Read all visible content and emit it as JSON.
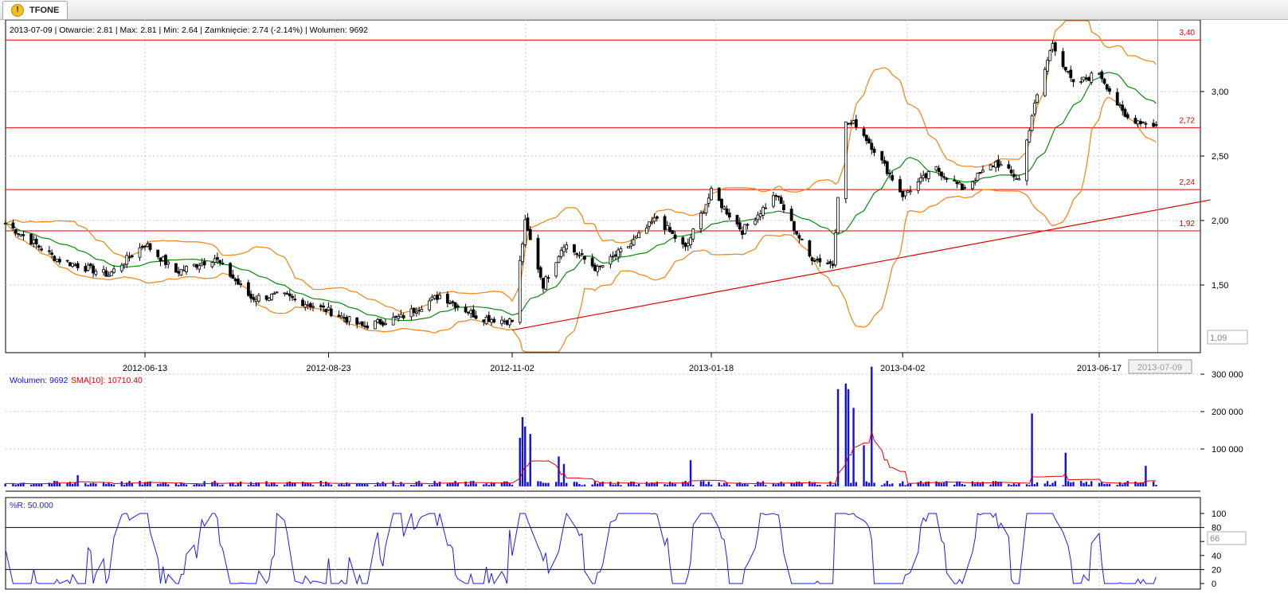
{
  "tab": {
    "label": "TFONE",
    "icon": "warning-icon"
  },
  "info_bar": {
    "date": "2013-07-09",
    "open": "Otwarcie: 2.81",
    "max": "Max: 2.81",
    "min": "Min: 2.64",
    "close": "Zamknięcie: 2.74 (-2.14%)",
    "volume": "Wolumen: 9692",
    "text": "2013-07-09 | Otwarcie: 2.81 | Max: 2.81 | Min: 2.64 | Zamknięcie: 2.74 (-2.14%)   | Wolumen: 9692"
  },
  "colors": {
    "candle": "#000000",
    "bollinger": "#f08a24",
    "sma": "#0a8a0a",
    "level": "#e00000",
    "volume_bar": "#1010e0",
    "volume_sma": "#e00000",
    "williams": "#1a1aff"
  },
  "chart_data": [
    {
      "type": "candlestick",
      "x_ticks": [
        "2012-06-13",
        "2012-08-23",
        "2012-11-02",
        "2013-01-18",
        "2013-04-02",
        "2013-06-17"
      ],
      "current_date_label": "2013-07-09",
      "y_ticks": [
        "3,00",
        "2,50",
        "2,00",
        "1,50"
      ],
      "ylim": [
        1.09,
        3.5
      ],
      "min_price_label": "1,09",
      "horizontal_levels": [
        {
          "value": 3.4,
          "label": "3,40"
        },
        {
          "value": 2.72,
          "label": "2,72"
        },
        {
          "value": 2.24,
          "label": "2,24"
        },
        {
          "value": 1.92,
          "label": "1,92"
        }
      ],
      "trendline": {
        "start": [
          "2012-11-02",
          1.15
        ],
        "end": [
          "2013-07-30",
          2.16
        ]
      },
      "close_anchors": [
        [
          "2012-04-20",
          1.98
        ],
        [
          "2012-05-10",
          1.7
        ],
        [
          "2012-05-30",
          1.58
        ],
        [
          "2012-06-13",
          1.82
        ],
        [
          "2012-06-25",
          1.6
        ],
        [
          "2012-07-10",
          1.71
        ],
        [
          "2012-07-24",
          1.4
        ],
        [
          "2012-08-05",
          1.42
        ],
        [
          "2012-08-23",
          1.3
        ],
        [
          "2012-09-05",
          1.18
        ],
        [
          "2012-09-20",
          1.25
        ],
        [
          "2012-10-05",
          1.42
        ],
        [
          "2012-10-20",
          1.25
        ],
        [
          "2012-11-02",
          1.22
        ],
        [
          "2012-11-07",
          1.98
        ],
        [
          "2012-11-14",
          1.5
        ],
        [
          "2012-11-22",
          1.82
        ],
        [
          "2012-12-05",
          1.62
        ],
        [
          "2012-12-18",
          1.82
        ],
        [
          "2012-12-28",
          2.02
        ],
        [
          "2013-01-08",
          1.78
        ],
        [
          "2013-01-18",
          2.22
        ],
        [
          "2013-01-30",
          1.92
        ],
        [
          "2013-02-12",
          2.2
        ],
        [
          "2013-02-25",
          1.72
        ],
        [
          "2013-03-06",
          1.66
        ],
        [
          "2013-03-10",
          2.75
        ],
        [
          "2013-03-15",
          2.75
        ],
        [
          "2013-03-22",
          2.55
        ],
        [
          "2013-04-02",
          2.2
        ],
        [
          "2013-04-15",
          2.4
        ],
        [
          "2013-04-25",
          2.25
        ],
        [
          "2013-05-08",
          2.45
        ],
        [
          "2013-05-17",
          2.32
        ],
        [
          "2013-05-22",
          2.82
        ],
        [
          "2013-05-30",
          3.38
        ],
        [
          "2013-06-07",
          3.05
        ],
        [
          "2013-06-17",
          3.15
        ],
        [
          "2013-06-27",
          2.8
        ],
        [
          "2013-07-09",
          2.74
        ]
      ]
    },
    {
      "type": "bar",
      "legend_volume": "Wolumen: 9692",
      "legend_sma": "SMA[10]: 10710.40",
      "y_ticks": [
        "300 000",
        "200 000",
        "100 000"
      ],
      "ylim": [
        0,
        320000
      ],
      "base_volume": 10700,
      "spikes": [
        [
          "2012-05-18",
          30000
        ],
        [
          "2012-11-05",
          130000
        ],
        [
          "2012-11-06",
          185000
        ],
        [
          "2012-11-07",
          160000
        ],
        [
          "2012-11-09",
          140000
        ],
        [
          "2012-11-20",
          80000
        ],
        [
          "2012-11-22",
          60000
        ],
        [
          "2013-01-10",
          70000
        ],
        [
          "2013-03-08",
          260000
        ],
        [
          "2013-03-11",
          275000
        ],
        [
          "2013-03-12",
          260000
        ],
        [
          "2013-03-14",
          210000
        ],
        [
          "2013-03-21",
          320000
        ],
        [
          "2013-03-18",
          110000
        ],
        [
          "2013-05-22",
          195000
        ],
        [
          "2013-06-04",
          90000
        ],
        [
          "2013-07-05",
          55000
        ]
      ]
    },
    {
      "type": "line",
      "legend": "%R: 50.000",
      "y_ticks": [
        "100",
        "80",
        "60",
        "40",
        "20",
        "0"
      ],
      "ylim": [
        0,
        100
      ],
      "current_label": "66",
      "levels": [
        80,
        20
      ]
    }
  ]
}
